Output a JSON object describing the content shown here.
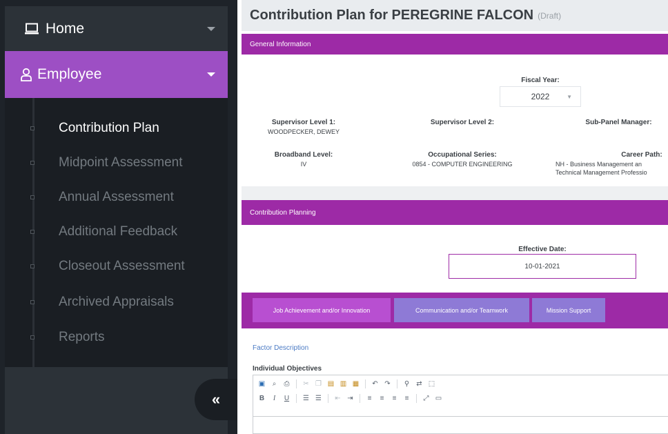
{
  "sidebar": {
    "home": {
      "label": "Home",
      "icon": "laptop-icon"
    },
    "employee": {
      "label": "Employee",
      "icon": "user-icon"
    },
    "items": [
      {
        "label": "Contribution Plan",
        "active": true
      },
      {
        "label": "Midpoint Assessment",
        "active": false
      },
      {
        "label": "Annual Assessment",
        "active": false
      },
      {
        "label": "Additional Feedback",
        "active": false
      },
      {
        "label": "Closeout Assessment",
        "active": false
      },
      {
        "label": "Archived Appraisals",
        "active": false
      },
      {
        "label": "Reports",
        "active": false
      }
    ],
    "collapse_label": "«"
  },
  "page": {
    "title": "Contribution Plan for PEREGRINE FALCON",
    "status": "(Draft)"
  },
  "general": {
    "header": "General Information",
    "fiscal_year_label": "Fiscal Year:",
    "fiscal_year_value": "2022",
    "sup1_label": "Supervisor Level 1:",
    "sup1_value": "WOODPECKER, DEWEY",
    "sup2_label": "Supervisor Level 2:",
    "subpanel_label": "Sub-Panel Manager:",
    "broadband_label": "Broadband Level:",
    "broadband_value": "IV",
    "occ_label": "Occupational Series:",
    "occ_value": "0854 - COMPUTER ENGINEERING",
    "career_label": "Career Path:",
    "career_value_1": "NH - Business Management an",
    "career_value_2": "Technical Management Professio"
  },
  "planning": {
    "header": "Contribution Planning",
    "effective_label": "Effective Date:",
    "effective_value": "10-01-2021"
  },
  "tabs": [
    {
      "label": "Job Achievement and/or Innovation",
      "active": true
    },
    {
      "label": "Communication and/or Teamwork",
      "active": false
    },
    {
      "label": "Mission Support",
      "active": false
    }
  ],
  "factor": {
    "link": "Factor Description",
    "objectives_label": "Individual Objectives"
  },
  "colors": {
    "sidebar_bg": "#1e2329",
    "accent_purple": "#9d4fc4",
    "header_magenta": "#9d2aa6",
    "tab_inactive": "#8e7ad6"
  }
}
